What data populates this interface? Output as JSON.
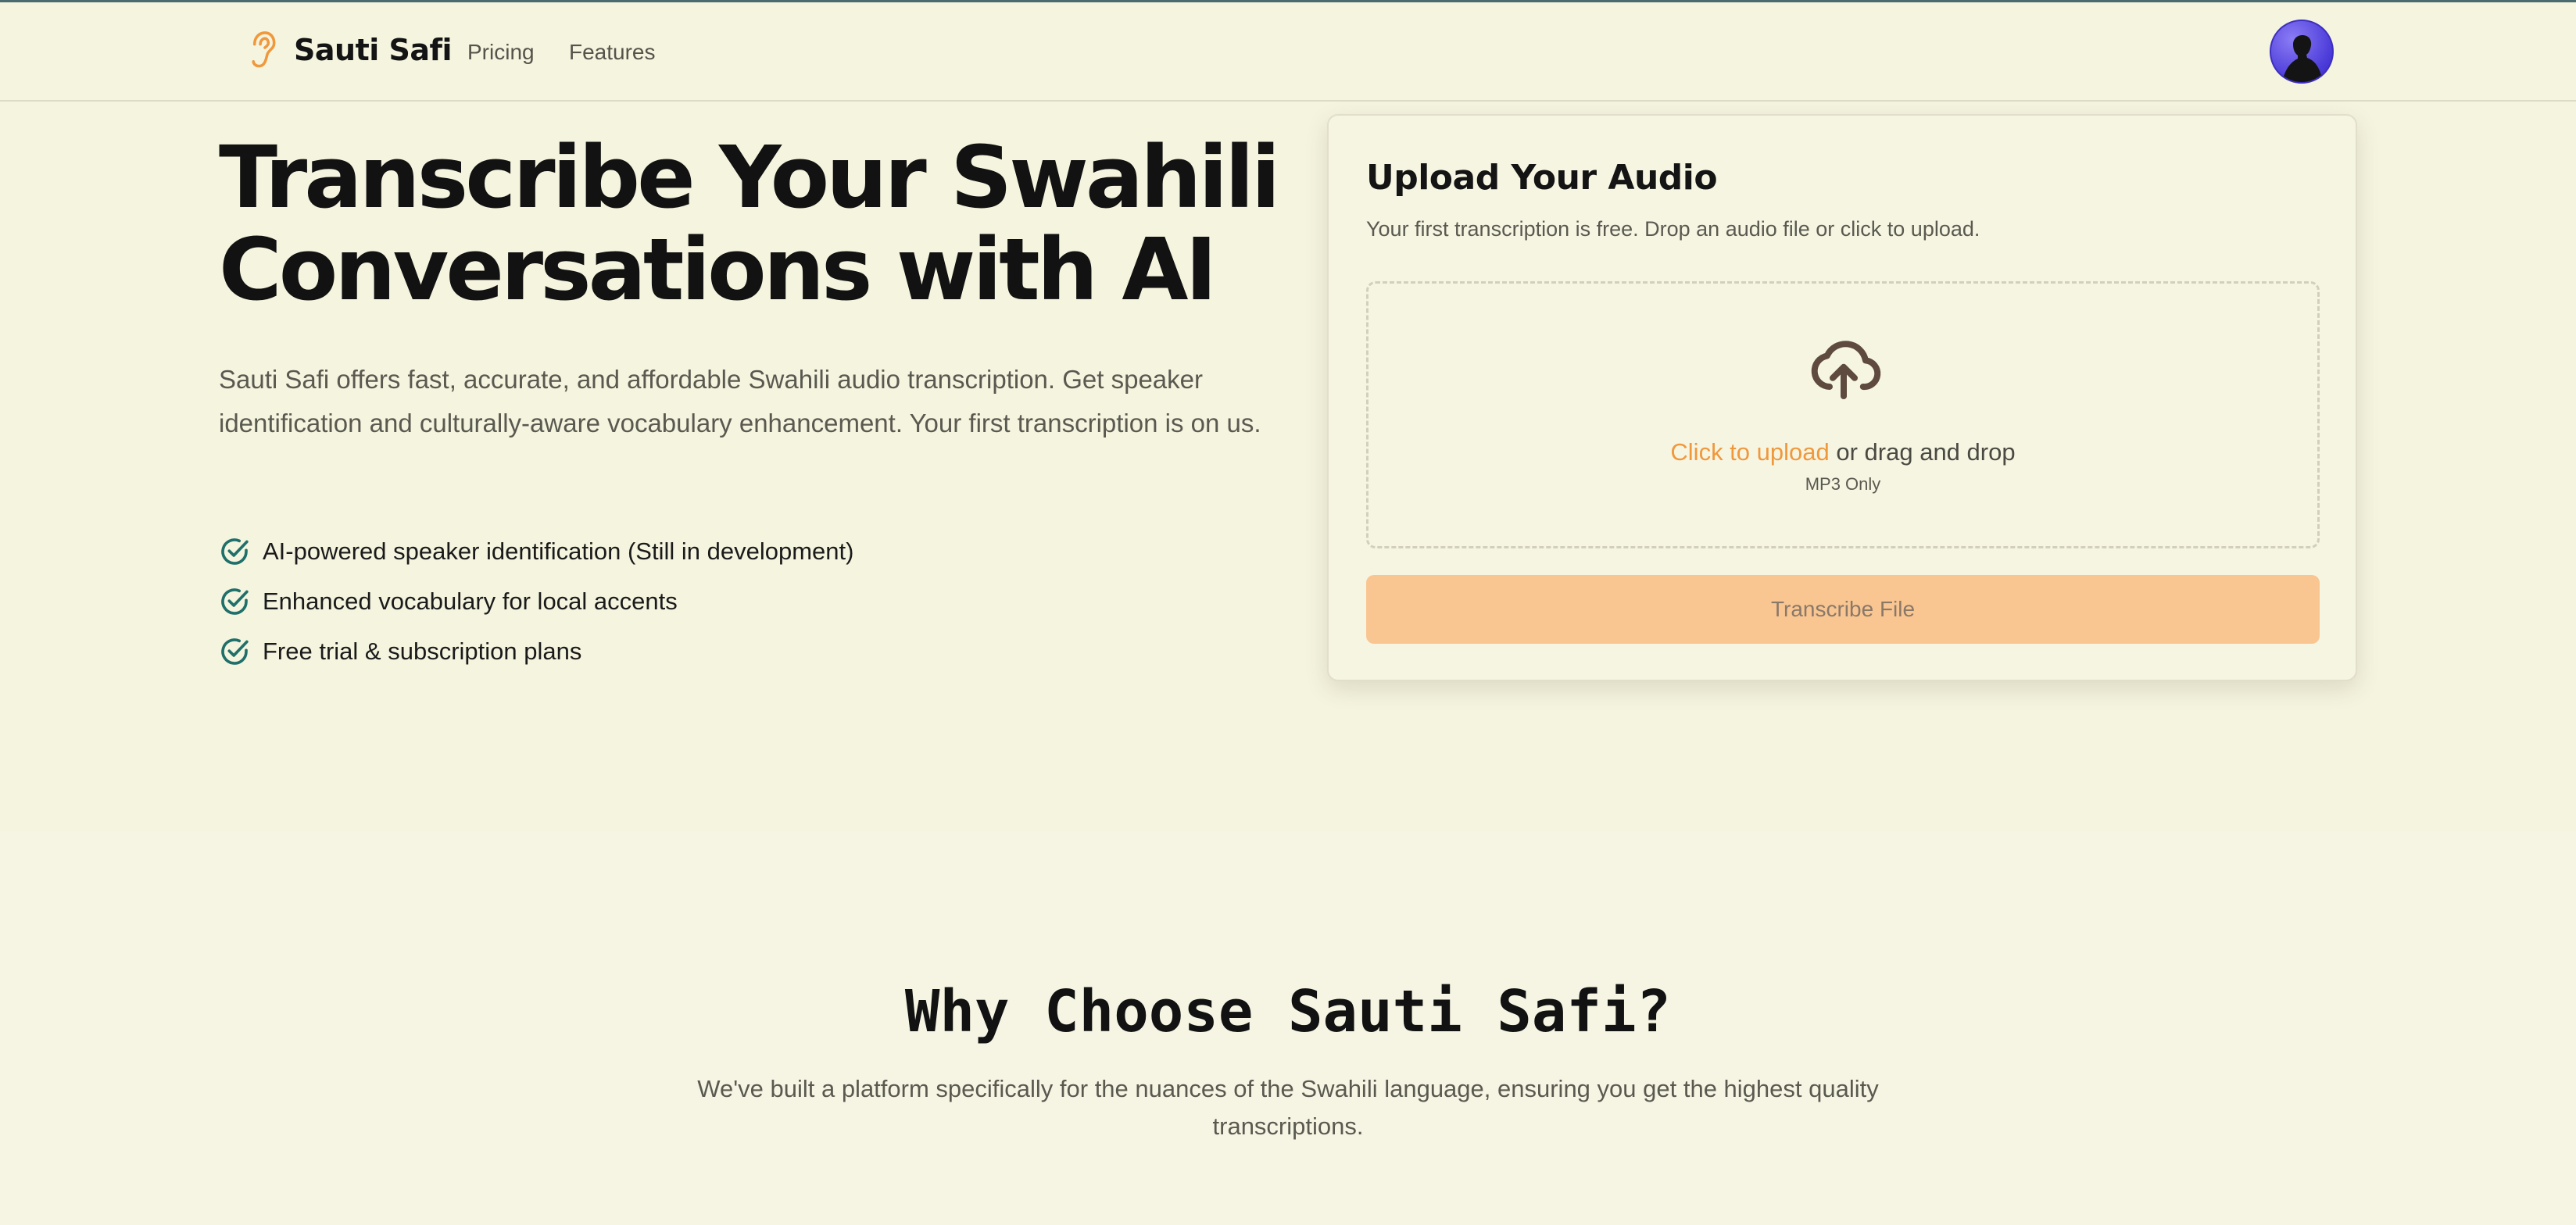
{
  "nav": {
    "brand": "Sauti Safi",
    "links": [
      "Pricing",
      "Features"
    ]
  },
  "hero": {
    "title_line1": "Transcribe Your Swahili",
    "title_line2": "Conversations with AI",
    "description": "Sauti Safi offers fast, accurate, and affordable Swahili audio transcription. Get speaker identification and culturally-aware vocabulary enhancement. Your first transcription is on us.",
    "features": [
      "AI-powered speaker identification (Still in development)",
      "Enhanced vocabulary for local accents",
      "Free trial & subscription plans"
    ]
  },
  "upload": {
    "title": "Upload Your Audio",
    "subtitle": "Your first transcription is free. Drop an audio file or click to upload.",
    "click_label": "Click to upload",
    "drag_label": " or drag and drop",
    "hint": "MP3 Only",
    "button": "Transcribe File"
  },
  "why": {
    "title": "Why Choose Sauti Safi?",
    "description": "We've built a platform specifically for the nuances of the Swahili language, ensuring you get the highest quality transcriptions."
  },
  "colors": {
    "background": "#f5f4df",
    "accent": "#f0983c",
    "check": "#1f6f6a",
    "button_disabled": "#f9c692"
  },
  "icons": {
    "logo": "ear-icon",
    "feature": "check-circle-icon",
    "upload": "cloud-upload-icon"
  }
}
